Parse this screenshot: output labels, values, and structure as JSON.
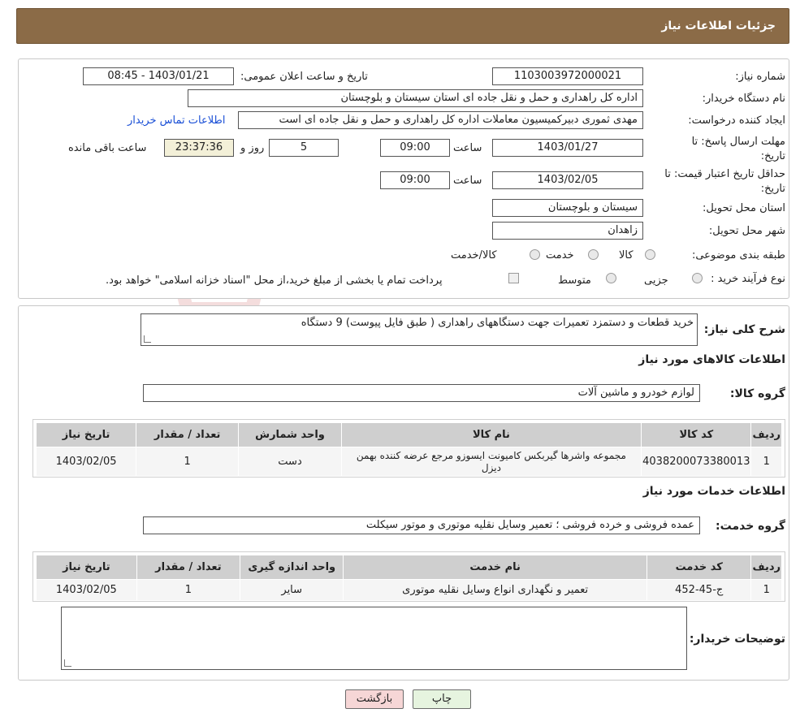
{
  "header": {
    "title": "جزئیات اطلاعات نیاز"
  },
  "form": {
    "need_number_label": "شماره نیاز:",
    "need_number": "1103003972000021",
    "announce_label": "تاریخ و ساعت اعلان عمومی:",
    "announce_value": "1403/01/21 - 08:45",
    "buyer_org_label": "نام دستگاه خریدار:",
    "buyer_org": "اداره کل راهداری و حمل و نقل جاده ای استان سیستان و بلوچستان",
    "creator_label": "ایجاد کننده درخواست:",
    "creator": "مهدی ثموری دبیرکمیسیون معاملات اداره کل راهداری و حمل و نقل جاده ای است",
    "contact_link": "اطلاعات تماس خریدار",
    "reply_deadline_label": "مهلت ارسال پاسخ: تا تاریخ:",
    "reply_date": "1403/01/27",
    "time_label": "ساعت",
    "reply_time": "09:00",
    "days_value": "5",
    "days_label": "روز و",
    "remaining_time": "23:37:36",
    "remaining_label": "ساعت باقی مانده",
    "validity_label": "حداقل تاریخ اعتبار قیمت: تا تاریخ:",
    "validity_date": "1403/02/05",
    "validity_time": "09:00",
    "province_label": "استان محل تحویل:",
    "province": "سیستان و بلوچستان",
    "city_label": "شهر محل تحویل:",
    "city": "زاهدان",
    "category_label": "طبقه بندی موضوعی:",
    "category_options": [
      "کالا",
      "خدمت",
      "کالا/خدمت"
    ],
    "process_label": "نوع فرآیند خرید :",
    "process_options": [
      "جزیی",
      "متوسط"
    ],
    "payment_note": "پرداخت تمام یا بخشی از مبلغ خرید،از محل \"اسناد خزانه اسلامی\" خواهد بود."
  },
  "details": {
    "desc_label": "شرح کلی نیاز:",
    "desc_value": "خرید قطعات و دستمزد تعمیرات جهت دستگاههای راهداری ( طبق فایل پیوست)  9 دستگاه",
    "goods_section": "اطلاعات کالاهای مورد نیاز",
    "goods_group_label": "گروه کالا:",
    "goods_group": "لوازم خودرو و ماشین آلات",
    "goods_headers": [
      "ردیف",
      "کد کالا",
      "نام کالا",
      "واحد شمارش",
      "تعداد / مقدار",
      "تاریخ نیاز"
    ],
    "goods_rows": [
      [
        "1",
        "4038200073380013",
        "مجموعه واشرها گیربکس کامیونت ایسوزو مرجع عرضه کننده بهمن دیزل",
        "دست",
        "1",
        "1403/02/05"
      ]
    ],
    "services_section": "اطلاعات خدمات مورد نیاز",
    "service_group_label": "گروه خدمت:",
    "service_group": "عمده فروشی و خرده فروشی ؛ تعمیر وسایل نقلیه موتوری و موتور سیکلت",
    "service_headers": [
      "ردیف",
      "کد خدمت",
      "نام خدمت",
      "واحد اندازه گیری",
      "تعداد / مقدار",
      "تاریخ نیاز"
    ],
    "service_rows": [
      [
        "1",
        "ج-45-452",
        "تعمیر و نگهداری انواع وسایل نقلیه موتوری",
        "سایر",
        "1",
        "1403/02/05"
      ]
    ],
    "buyer_notes_label": "توضیحات خریدار:",
    "buyer_notes": ""
  },
  "buttons": {
    "print": "چاپ",
    "back": "بازگشت"
  },
  "watermark": {
    "text": "AriaTender.neT"
  }
}
